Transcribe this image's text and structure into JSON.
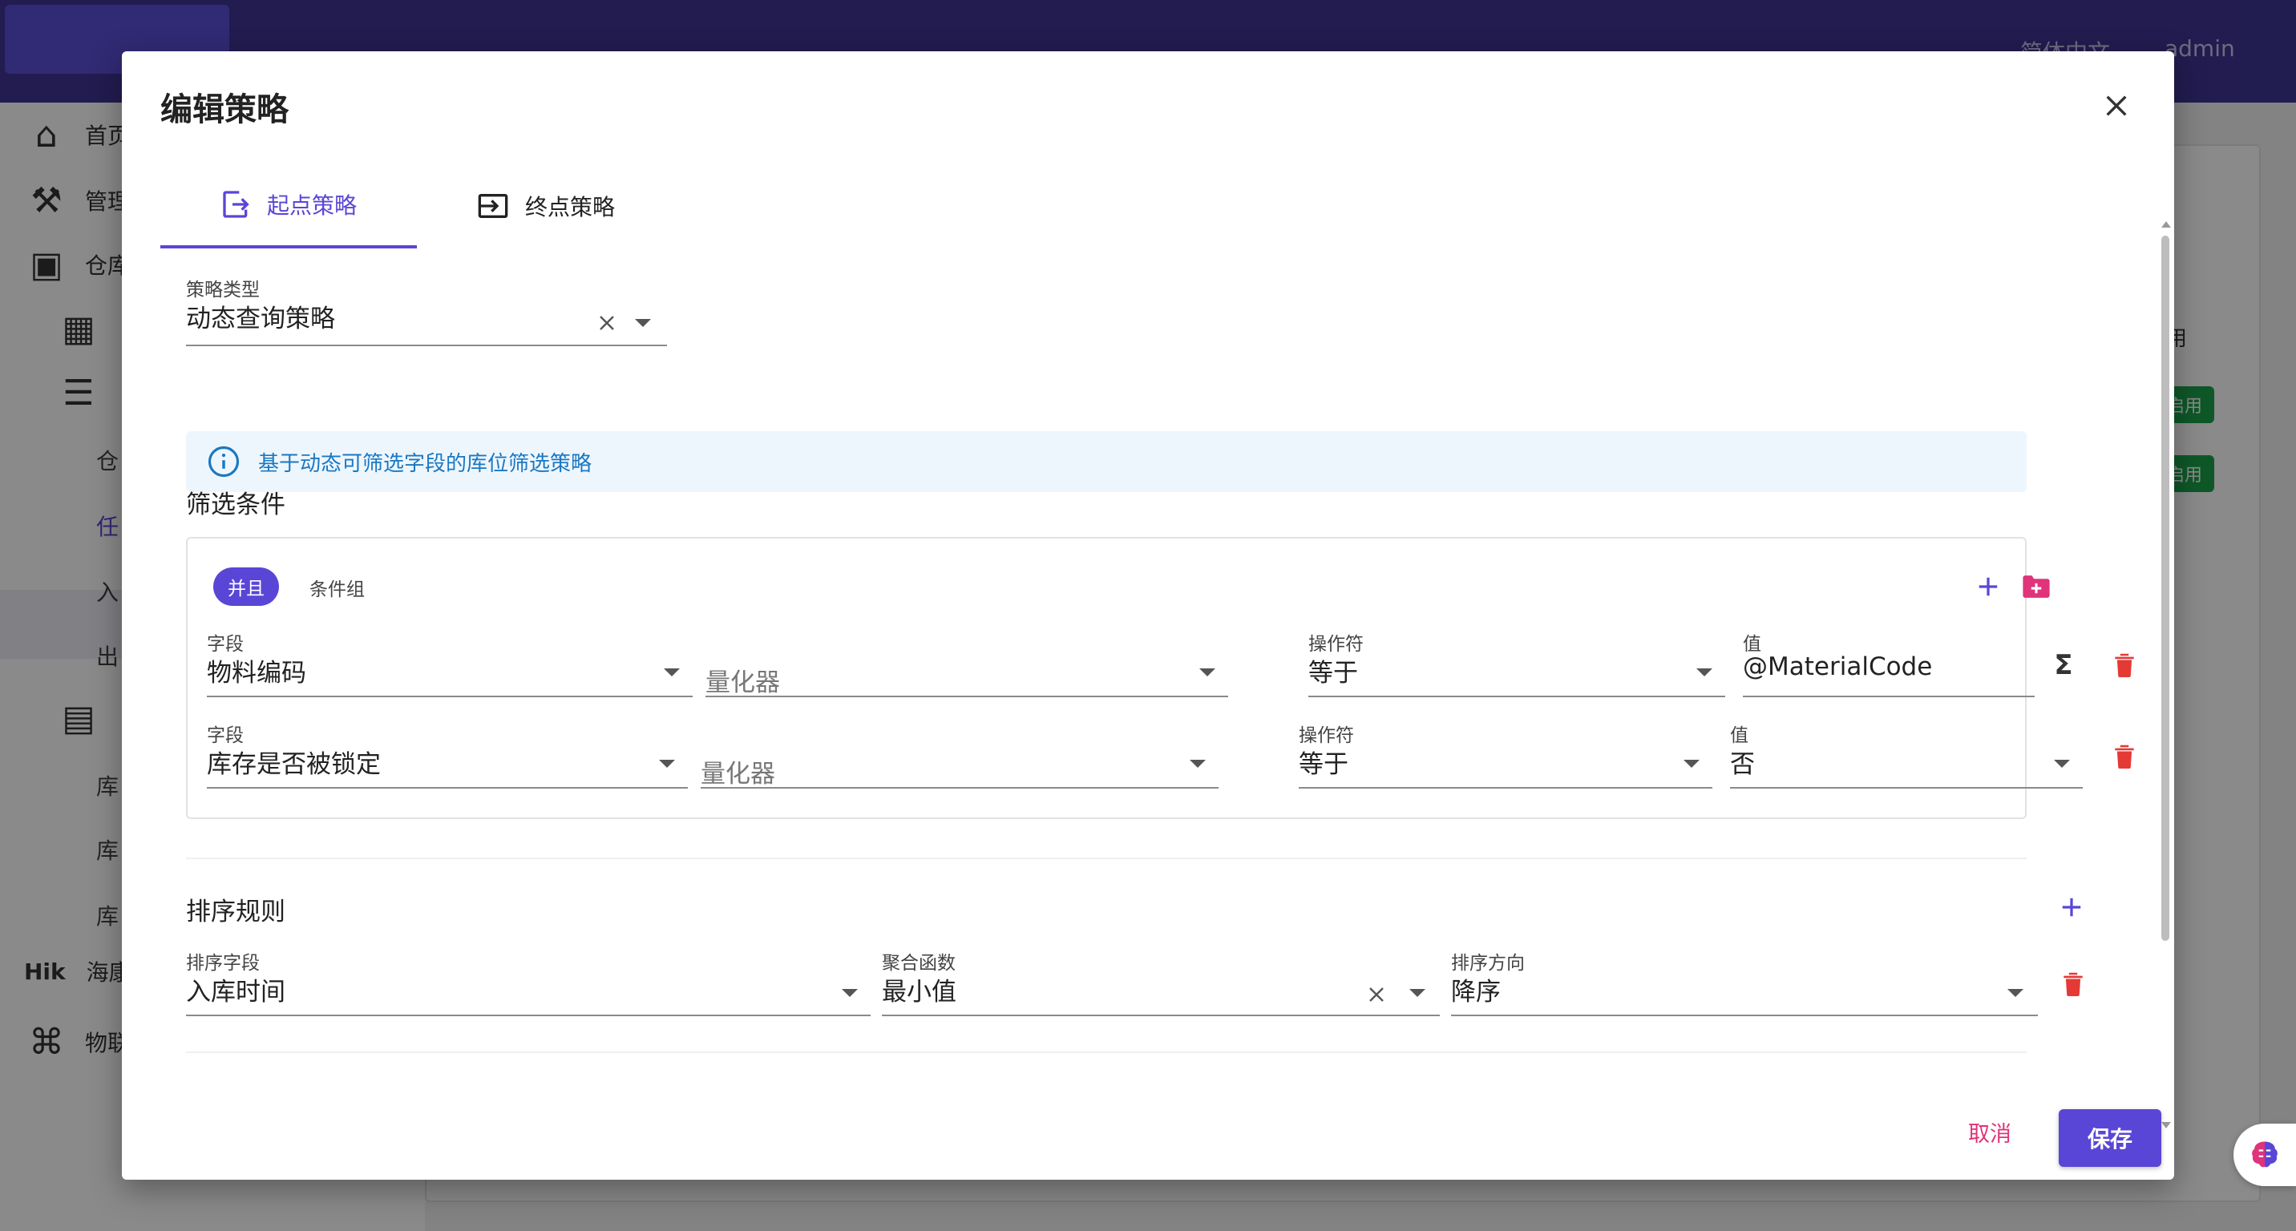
{
  "app": {
    "language_label": "简体中文",
    "user_name": "admin",
    "sidebar": {
      "items": [
        "首页",
        "管理",
        "仓库"
      ],
      "sub_items": [
        "仓",
        "任",
        "入",
        "出",
        "库",
        "库",
        "库"
      ],
      "brand_text": "Hik",
      "brand_name": "海康",
      "iot_label": "物联"
    },
    "bg_badges": [
      "启用",
      "启用"
    ],
    "bg_header_fragment": "用"
  },
  "dialog": {
    "title": "编辑策略",
    "tabs": [
      {
        "label": "起点策略",
        "active": true
      },
      {
        "label": "终点策略",
        "active": false
      }
    ],
    "strategy_type": {
      "label": "策略类型",
      "value": "动态查询策略"
    },
    "info_message": "基于动态可筛选字段的库位筛选策略",
    "filter_section": {
      "title": "筛选条件",
      "logic_chip": "并且",
      "group_label": "条件组",
      "rows": [
        {
          "field_label": "字段",
          "field_value": "物料编码",
          "quantifier_placeholder": "量化器",
          "operator_label": "操作符",
          "operator_value": "等于",
          "value_label": "值",
          "value": "@MaterialCode"
        },
        {
          "field_label": "字段",
          "field_value": "库存是否被锁定",
          "quantifier_placeholder": "量化器",
          "operator_label": "操作符",
          "operator_value": "等于",
          "value_label": "值",
          "value": "否"
        }
      ]
    },
    "sort_section": {
      "title": "排序规则",
      "row": {
        "sort_field_label": "排序字段",
        "sort_field_value": "入库时间",
        "agg_label": "聚合函数",
        "agg_value": "最小值",
        "direction_label": "排序方向",
        "direction_value": "降序"
      }
    },
    "footer": {
      "cancel_label": "取消",
      "save_label": "保存"
    },
    "colors": {
      "accent": "#5a46d6",
      "danger": "#e53935",
      "folder": "#e0337a",
      "info": "#1a78c2"
    }
  }
}
